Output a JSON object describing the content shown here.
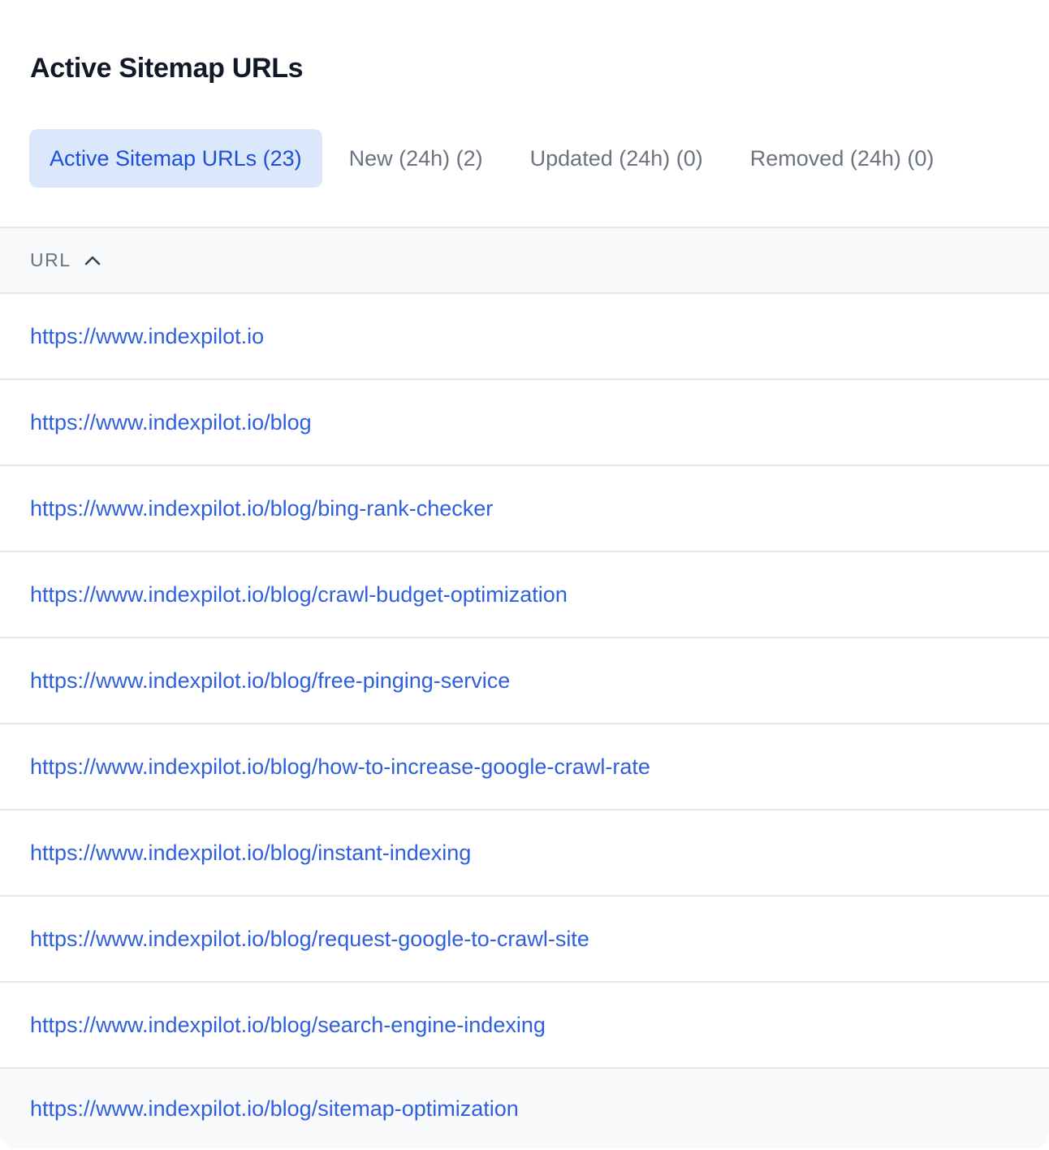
{
  "header": {
    "title": "Active Sitemap URLs"
  },
  "tabs": [
    {
      "label": "Active Sitemap URLs (23)",
      "active": true
    },
    {
      "label": "New (24h) (2)",
      "active": false
    },
    {
      "label": "Updated (24h) (0)",
      "active": false
    },
    {
      "label": "Removed (24h) (0)",
      "active": false
    }
  ],
  "table": {
    "column_header": "URL",
    "sort_icon": "chevron-up-icon",
    "rows": [
      "https://www.indexpilot.io",
      "https://www.indexpilot.io/blog",
      "https://www.indexpilot.io/blog/bing-rank-checker",
      "https://www.indexpilot.io/blog/crawl-budget-optimization",
      "https://www.indexpilot.io/blog/free-pinging-service",
      "https://www.indexpilot.io/blog/how-to-increase-google-crawl-rate",
      "https://www.indexpilot.io/blog/instant-indexing",
      "https://www.indexpilot.io/blog/request-google-to-crawl-site",
      "https://www.indexpilot.io/blog/search-engine-indexing",
      "https://www.indexpilot.io/blog/sitemap-optimization"
    ]
  },
  "colors": {
    "accent": "#1d4ed8",
    "link": "#2f5fdc",
    "active_tab_bg": "#dbe7fb",
    "muted_text": "#6b7280",
    "border": "#e5e7eb",
    "header_bg": "#f8f9fb"
  }
}
